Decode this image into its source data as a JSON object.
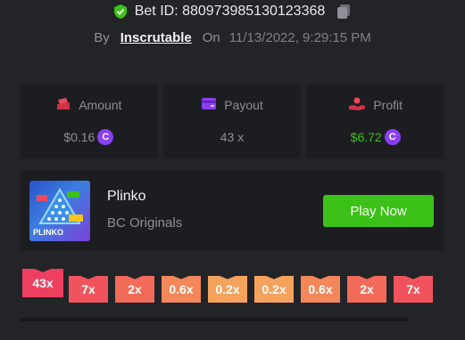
{
  "bet": {
    "id_label": "Bet ID: 880973985130123368",
    "by_label": "By",
    "user": "Inscrutable",
    "on_label": "On",
    "datetime": "11/13/2022, 9:29:15 PM"
  },
  "stats": {
    "amount": {
      "label": "Amount",
      "value": "$0.16"
    },
    "payout": {
      "label": "Payout",
      "value": "43 x"
    },
    "profit": {
      "label": "Profit",
      "value": "$6.72"
    }
  },
  "game": {
    "name": "Plinko",
    "provider": "BC Originals",
    "thumbnail_label": "PLINKO",
    "play_label": "Play Now"
  },
  "multipliers": [
    {
      "label": "43x",
      "color": "#ef3f5f",
      "active": true
    },
    {
      "label": "7x",
      "color": "#f0535b"
    },
    {
      "label": "2x",
      "color": "#f26a58"
    },
    {
      "label": "0.6x",
      "color": "#f3875a"
    },
    {
      "label": "0.2x",
      "color": "#f5a25c"
    },
    {
      "label": "0.2x",
      "color": "#f5a25c"
    },
    {
      "label": "0.6x",
      "color": "#f3875a"
    },
    {
      "label": "2x",
      "color": "#f26a58"
    },
    {
      "label": "7x",
      "color": "#f0535b"
    }
  ],
  "colors": {
    "accent_green": "#3bc117",
    "coin_purple": "#8a3ff0",
    "card_bg": "#1c1d21",
    "page_bg": "#232428"
  },
  "icons": {
    "verified": "shield-check-icon",
    "copy": "copy-icon",
    "amount": "bet-chip-icon",
    "payout": "wallet-card-icon",
    "profit": "profit-hand-icon",
    "coin": "bcd-coin-icon"
  }
}
